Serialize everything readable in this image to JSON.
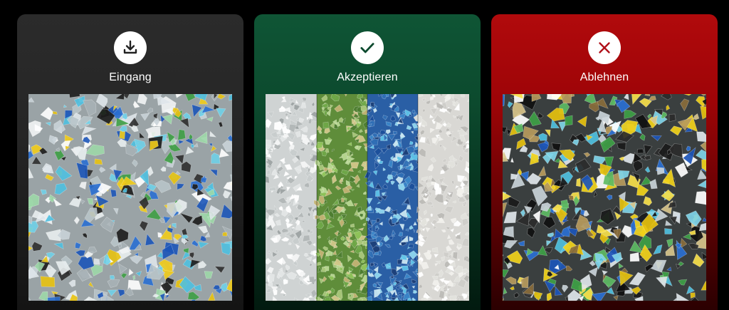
{
  "cards": [
    {
      "id": "incoming",
      "label": "Eingang",
      "icon": "download-icon",
      "background": "#262626",
      "icon_color": "#222222",
      "image": "mixed-glass-cullet-photo"
    },
    {
      "id": "accept",
      "label": "Akzeptieren",
      "icon": "checkmark-icon",
      "background": "#0c4a2e",
      "icon_color": "#0c4a2e",
      "image": "sorted-glass-by-color-photo"
    },
    {
      "id": "reject",
      "label": "Ablehnen",
      "icon": "close-icon",
      "background": "#9d0407",
      "icon_color": "#b0111a",
      "image": "contaminated-glass-cullet-photo"
    }
  ]
}
